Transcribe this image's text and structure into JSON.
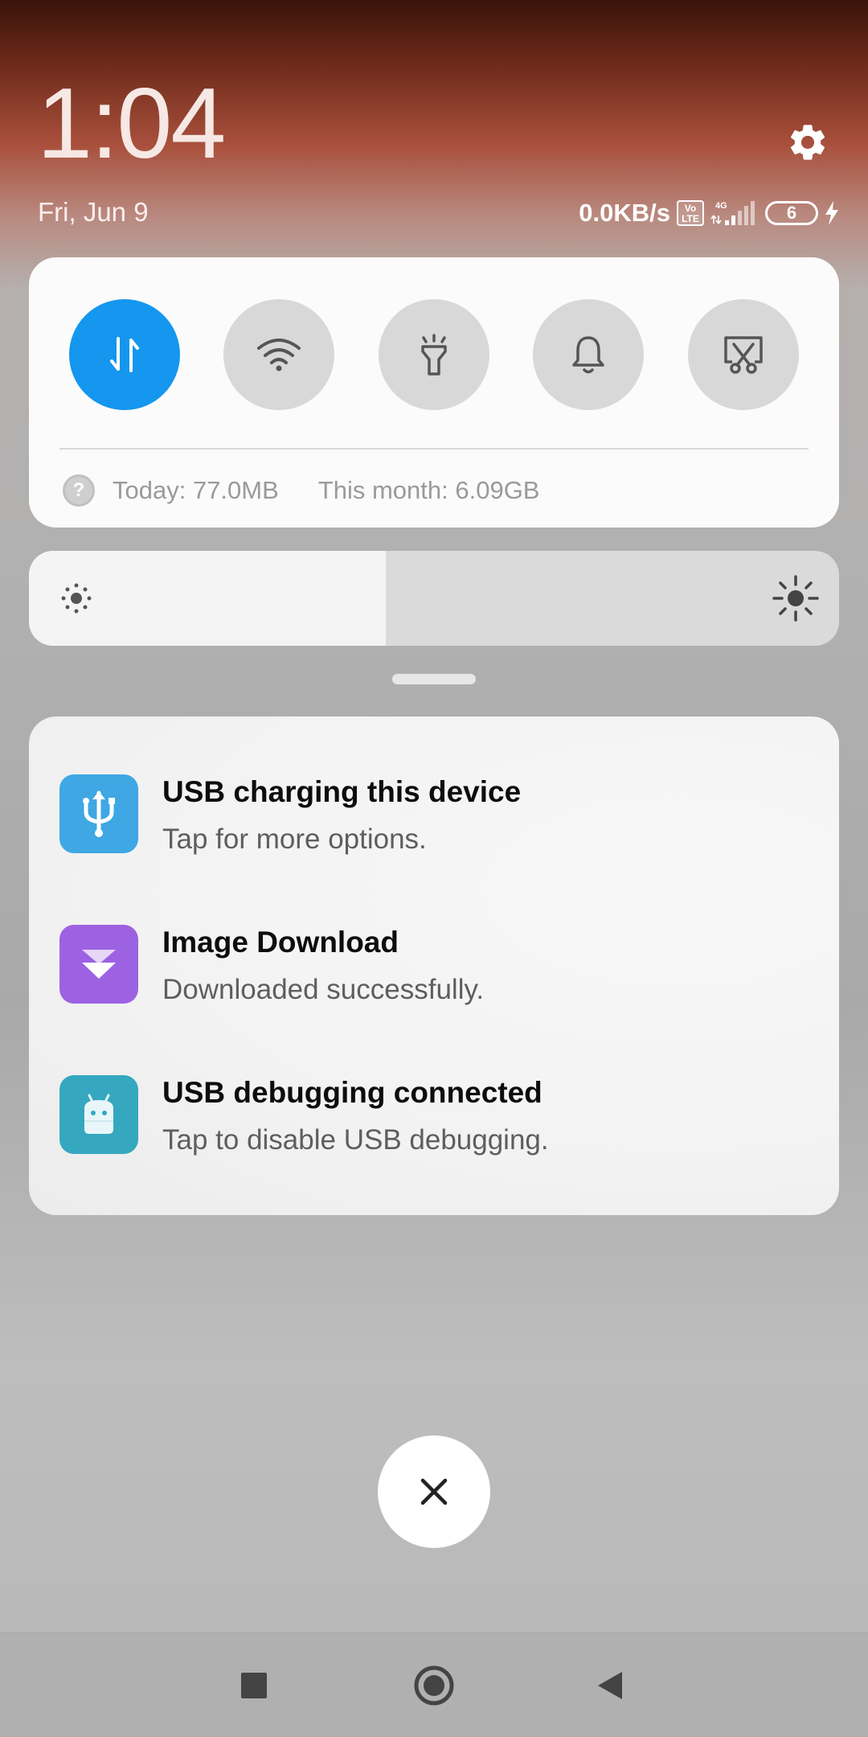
{
  "header": {
    "time": "1:04",
    "date": "Fri, Jun 9",
    "settings_icon": "gear-icon"
  },
  "status_bar": {
    "net_speed": "0.0KB/s",
    "volte_line1": "Vo",
    "volte_line2": "LTE",
    "network_type": "4G",
    "battery_level": "6",
    "charging": true
  },
  "quick_settings": {
    "toggles": [
      {
        "name": "mobile-data",
        "icon": "data-arrows-icon",
        "active": true
      },
      {
        "name": "wifi",
        "icon": "wifi-icon",
        "active": false
      },
      {
        "name": "flashlight",
        "icon": "flashlight-icon",
        "active": false
      },
      {
        "name": "sound",
        "icon": "bell-icon",
        "active": false
      },
      {
        "name": "screenshot",
        "icon": "scissors-screenshot-icon",
        "active": false
      }
    ],
    "usage_today": "Today: 77.0MB",
    "usage_month": "This month: 6.09GB",
    "help_glyph": "?"
  },
  "brightness": {
    "level_fraction": 0.44
  },
  "notifications": [
    {
      "title": "USB charging this device",
      "subtitle": "Tap for more options.",
      "icon": "usb-icon",
      "color": "#3fa7e4"
    },
    {
      "title": "Image Download",
      "subtitle": "Downloaded successfully.",
      "icon": "download-icon",
      "color": "#9d62e2"
    },
    {
      "title": "USB debugging connected",
      "subtitle": "Tap to disable USB debugging.",
      "icon": "android-debug-icon",
      "color": "#35a8c0"
    }
  ],
  "clear_all": {
    "icon": "close-icon"
  },
  "nav_bar": {
    "buttons": [
      "recents-icon",
      "home-icon",
      "back-icon"
    ]
  },
  "colors": {
    "accent": "#1596ef"
  }
}
